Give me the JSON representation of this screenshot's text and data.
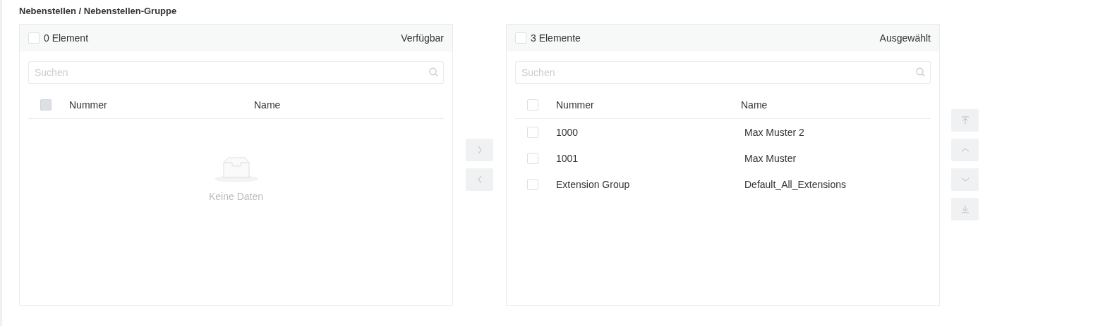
{
  "title": "Nebenstellen / Nebenstellen-Gruppe",
  "panels": [
    {
      "count": "0 Element",
      "label": "Verfügbar",
      "select_all": {
        "checked": false
      },
      "column_checkbox": {
        "checked": false,
        "disabled": true
      },
      "search": {
        "placeholder": "Suchen"
      },
      "columns": [
        "Nummer",
        "Name"
      ],
      "empty_text": "Keine Daten"
    },
    {
      "count": "3 Elemente",
      "label": "Ausgewählt",
      "select_all": {
        "checked": false
      },
      "column_checkbox": {
        "checked": false,
        "disabled": false
      },
      "search": {
        "placeholder": "Suchen"
      },
      "columns": [
        "Nummer",
        "Name"
      ],
      "rows": [
        {
          "number": "1000",
          "name": "Max Muster 2",
          "checked": false
        },
        {
          "number": "1001",
          "name": "Max Muster",
          "checked": false
        },
        {
          "number": "Extension Group",
          "name": "Default_All_Extensions",
          "checked": false
        }
      ]
    }
  ],
  "transfer_buttons": [
    {
      "kind": "right",
      "disabled": true
    },
    {
      "kind": "left",
      "disabled": true
    }
  ],
  "order_buttons": [
    {
      "kind": "top",
      "disabled": true
    },
    {
      "kind": "up",
      "disabled": true
    },
    {
      "kind": "down",
      "disabled": true
    },
    {
      "kind": "bottom",
      "disabled": true
    }
  ]
}
